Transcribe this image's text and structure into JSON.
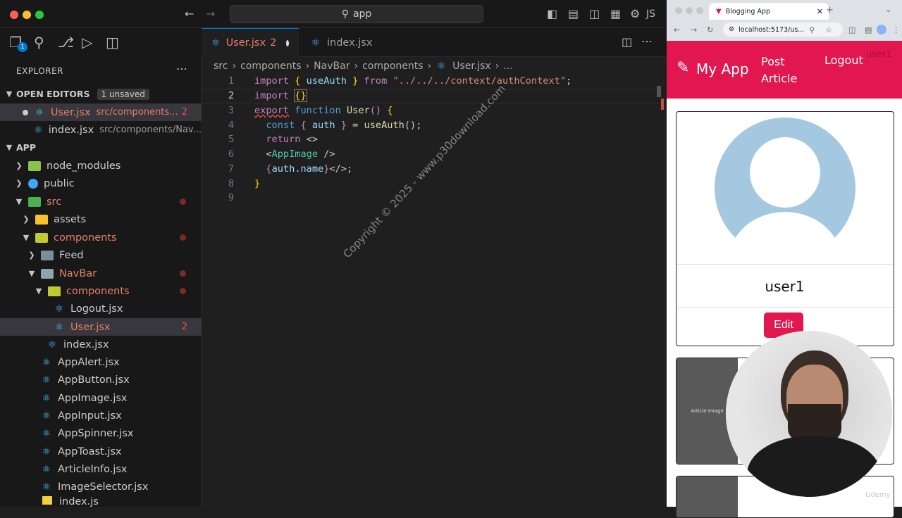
{
  "vscode": {
    "command_center": "app",
    "title_right": "JS",
    "explorer_title": "EXPLORER",
    "explorer_badge": "1",
    "open_editors": {
      "title": "OPEN EDITORS",
      "badge": "1 unsaved",
      "items": [
        {
          "name": "User.jsx",
          "path": "src/components...",
          "count": "2"
        },
        {
          "name": "index.jsx",
          "path": "src/components/Nav..."
        }
      ]
    },
    "folder_title": "APP",
    "tree": [
      {
        "label": "node_modules"
      },
      {
        "label": "public"
      },
      {
        "label": "src"
      },
      {
        "label": "assets"
      },
      {
        "label": "components"
      },
      {
        "label": "Feed"
      },
      {
        "label": "NavBar"
      },
      {
        "label": "components"
      },
      {
        "label": "Logout.jsx"
      },
      {
        "label": "User.jsx",
        "count": "2"
      },
      {
        "label": "index.jsx"
      },
      {
        "label": "AppAlert.jsx"
      },
      {
        "label": "AppButton.jsx"
      },
      {
        "label": "AppImage.jsx"
      },
      {
        "label": "AppInput.jsx"
      },
      {
        "label": "AppSpinner.jsx"
      },
      {
        "label": "AppToast.jsx"
      },
      {
        "label": "ArticleInfo.jsx"
      },
      {
        "label": "ImageSelector.jsx"
      },
      {
        "label": "index.js"
      }
    ],
    "tabs": [
      {
        "label": "User.jsx",
        "count": "2"
      },
      {
        "label": "index.jsx"
      }
    ],
    "breadcrumb": [
      "src",
      "components",
      "NavBar",
      "components",
      "User.jsx",
      "..."
    ],
    "line_numbers": [
      "1",
      "2",
      "3",
      "4",
      "5",
      "6",
      "7",
      "8",
      "9"
    ],
    "code": {
      "l1": {
        "a": "import",
        "b": "{",
        "c": "useAuth",
        "d": "}",
        "e": "from",
        "f": "\"../../../context/authContext\"",
        "g": ";"
      },
      "l2": {
        "a": "import",
        "b": "{}"
      },
      "l3": {
        "a": "export",
        "b": "function",
        "c": "User",
        "d": "()",
        "e": "{"
      },
      "l4": {
        "a": "const",
        "b": "{",
        "c": "auth",
        "d": "}",
        "e": "=",
        "f": "useAuth",
        "g": "();"
      },
      "l5": {
        "a": "return",
        "b": "<>"
      },
      "l6": {
        "a": "<",
        "b": "AppImage",
        "c": "/>"
      },
      "l7": {
        "a": "{",
        "b": "auth",
        "c": ".name",
        "d": "}",
        "e": "</>;"
      },
      "l8": {
        "a": "}"
      }
    },
    "watermark": "Copyright © 2025 - www.p30download.com"
  },
  "browser": {
    "tab_title": "Blogging App",
    "url": "localhost:5173/us...",
    "nav": {
      "brand": "My App",
      "post": "Post Article",
      "logout": "Logout",
      "user": "user1"
    },
    "card": {
      "username": "user1",
      "edit": "Edit"
    },
    "article_image_label": "Article Image",
    "udemy": "Udemy"
  },
  "colors": {
    "accent": "#e2174f",
    "avatar": "#a3c8e0",
    "editor_bg": "#1f1f1f"
  }
}
